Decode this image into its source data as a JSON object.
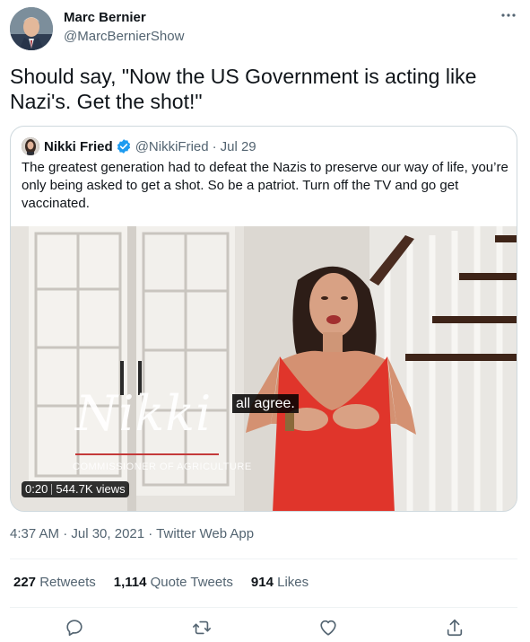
{
  "tweet": {
    "author_name": "Marc Bernier",
    "author_handle": "@MarcBernierShow",
    "text": "Should say, \"Now the US Government is acting like Nazi's. Get the shot!\"",
    "timestamp": "4:37 AM · Jul 30, 2021 · ",
    "source": "Twitter Web App",
    "more_icon": "more-horizontal-icon"
  },
  "quote": {
    "author_name": "Nikki Fried",
    "author_handle": "@NikkiFried",
    "separator": "·",
    "date": "Jul 29",
    "text": "The greatest generation had to defeat the Nazis to preserve our way of life, you’re only being asked to get a shot. So be a patriot. Turn off the TV and go get vaccinated.",
    "video": {
      "subtitle": "all agree.",
      "watermark_name": "Nikki",
      "watermark_title": "COMMISSIONER OF AGRICULTURE",
      "duration": "0:20",
      "views": "544.7K views"
    }
  },
  "stats": {
    "retweets_count": "227",
    "retweets_label": "Retweets",
    "quotes_count": "1,114",
    "quotes_label": "Quote Tweets",
    "likes_count": "914",
    "likes_label": "Likes"
  },
  "actions": [
    "reply-icon",
    "retweet-icon",
    "like-icon",
    "share-icon"
  ],
  "colors": {
    "text": "#0f1419",
    "secondary": "#536471",
    "verified": "#1d9bf0",
    "border": "#cfd9de",
    "dress": "#e0352b"
  }
}
